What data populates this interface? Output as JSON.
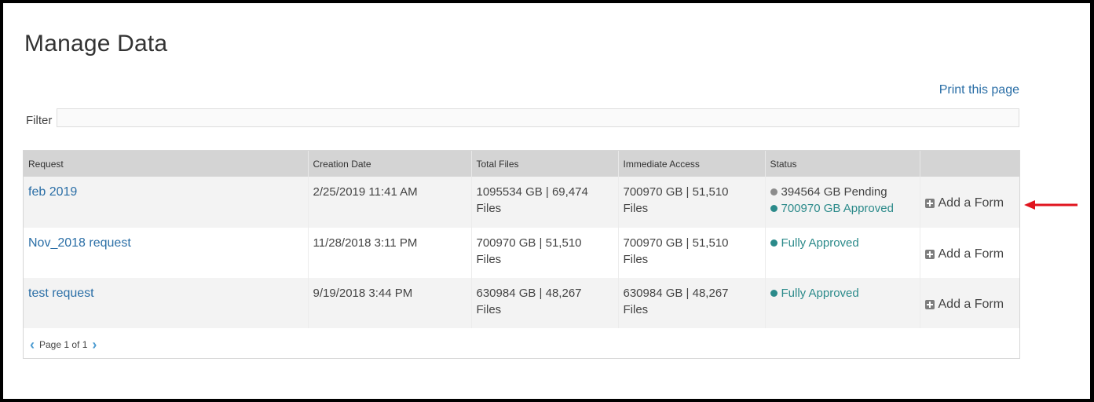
{
  "page": {
    "title": "Manage Data",
    "print_link": "Print this page"
  },
  "filter": {
    "label": "Filter",
    "value": ""
  },
  "table": {
    "headers": [
      "Request",
      "Creation Date",
      "Total Files",
      "Immediate Access",
      "Status",
      ""
    ],
    "rows": [
      {
        "request": "feb 2019",
        "created": "2/25/2019 11:41 AM",
        "total_a": "1095534 GB | 69,474",
        "total_b": "Files",
        "access_a": "700970 GB | 51,510",
        "access_b": "Files",
        "status_pending": "394564 GB Pending",
        "status_approved": "700970 GB Approved",
        "action": "Add a Form"
      },
      {
        "request": "Nov_2018 request",
        "created": "11/28/2018 3:11 PM",
        "total_a": "700970 GB | 51,510",
        "total_b": "Files",
        "access_a": "700970 GB | 51,510",
        "access_b": "Files",
        "status_approved": "Fully Approved",
        "action": "Add a Form"
      },
      {
        "request": "test request",
        "created": "9/19/2018 3:44 PM",
        "total_a": "630984 GB | 48,267",
        "total_b": "Files",
        "access_a": "630984 GB | 48,267",
        "access_b": "Files",
        "status_approved": "Fully Approved",
        "action": "Add a Form"
      }
    ]
  },
  "pager": {
    "label": "Page 1 of 1"
  },
  "colors": {
    "link": "#2a6ea6",
    "approved": "#2b8a8a",
    "pending": "#8c8c8c",
    "annotation_arrow": "#e0141e"
  }
}
